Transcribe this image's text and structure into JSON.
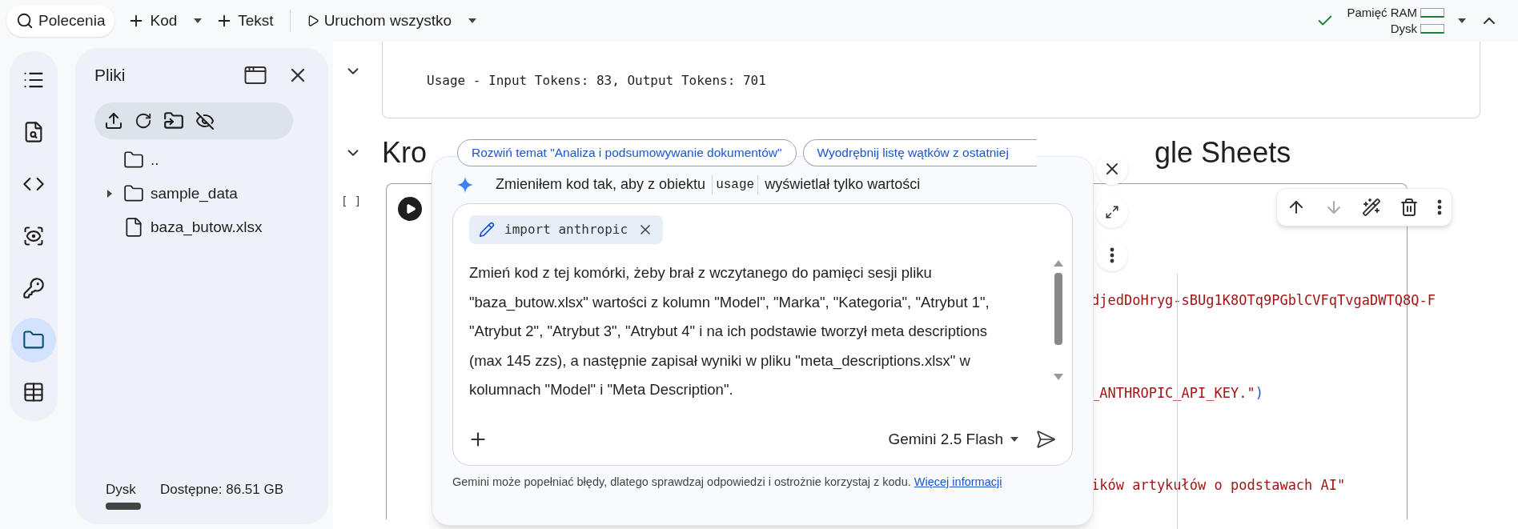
{
  "toolbar": {
    "buttons": [
      {
        "label": "Polecenia",
        "kind": "search",
        "dropdown": false,
        "selected": true
      },
      {
        "label": "Kod",
        "kind": "add",
        "dropdown": true,
        "selected": false
      },
      {
        "label": "Tekst",
        "kind": "add",
        "dropdown": false,
        "selected": false
      },
      {
        "label": "Uruchom wszystko",
        "kind": "run",
        "dropdown": true,
        "selected": false
      }
    ],
    "resources": {
      "connected": true,
      "labels": [
        "Pamięć RAM",
        "Dysk"
      ]
    }
  },
  "rail": [
    {
      "kind": "toc",
      "selected": false
    },
    {
      "kind": "find",
      "selected": false
    },
    {
      "kind": "code",
      "selected": false
    },
    {
      "kind": "variables",
      "selected": false
    },
    {
      "kind": "secrets",
      "selected": false
    },
    {
      "kind": "files",
      "selected": true
    },
    {
      "kind": "table",
      "selected": false
    }
  ],
  "files_panel": {
    "title": "Pliki",
    "tree": [
      {
        "name": "..",
        "kind": "folder"
      },
      {
        "name": "sample_data",
        "kind": "folder",
        "expanded": false
      },
      {
        "name": "baza_butow.xlsx",
        "kind": "file"
      }
    ],
    "footer": {
      "tab": "Dysk",
      "available": "Dostępne: 86.51 GB"
    }
  },
  "notebook": {
    "output_line": "Usage - Input Tokens: 83, Output Tokens: 701",
    "heading_parts": [
      "Kro",
      "gle Sheets"
    ],
    "cell": {
      "exec_label": "[ ]",
      "code_lines": [
        {
          "text": "djedDoHryg-sBUg1K8OTq9PGblCVFqTvgaDWTQ8Q-F",
          "kind": "string"
        },
        {
          "text": "_ANTHROPIC_API_KEY.\"",
          "kind": "string",
          "tail": ")"
        },
        {
          "text": "ików artykułów o podstawach AI\"",
          "kind": "string"
        }
      ]
    },
    "cell_toolbar": [
      {
        "kind": "up",
        "disabled": false
      },
      {
        "kind": "down",
        "disabled": true
      },
      {
        "kind": "ai-edit",
        "disabled": false
      },
      {
        "kind": "delete",
        "disabled": false
      },
      {
        "kind": "more",
        "disabled": false
      }
    ]
  },
  "gemini": {
    "suggestions": [
      "Rozwiń temat \"Analiza i podsumowywanie dokumentów\"",
      "Wyodrębnij listę wątków z ostatniej"
    ],
    "message": {
      "before": "Zmieniłem kod tak, aby z obiektu",
      "code": "usage",
      "after": "wyświetlał tylko wartości"
    },
    "context_chip": "import anthropic",
    "prompt": "Zmień kod z tej komórki, żeby brał z wczytanego do pamięci sesji pliku \"baza_butow.xlsx\" wartości z kolumn \"Model\", \"Marka\", \"Kategoria\", \"Atrybut 1\", \"Atrybut 2\", \"Atrybut 3\", \"Atrybut 4\" i na ich podstawie tworzył meta descriptions (max 145 zzs), a następnie zapisał wyniki w pliku \"meta_descriptions.xlsx\" w kolumnach \"Model\" i \"Meta Description\".",
    "model": "Gemini 2.5 Flash",
    "disclaimer": "Gemini może popełniać błędy, dlatego sprawdzaj odpowiedzi i ostrożnie korzystaj z kodu.",
    "link": "Więcej informacji"
  }
}
